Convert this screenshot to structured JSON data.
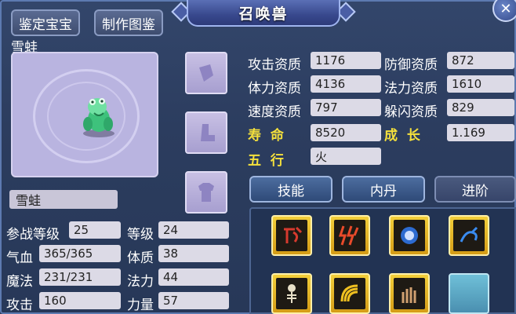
{
  "window": {
    "title": "召唤兽",
    "close_symbol": "✕"
  },
  "toolbar": {
    "identify_label": "鉴定宝宝",
    "atlas_label": "制作图鉴"
  },
  "pet": {
    "name_display": "雪蛙",
    "name_field": "雪蛙"
  },
  "left_stats": [
    {
      "label": "参战等级",
      "value": "25"
    },
    {
      "label": "等级",
      "value": "24"
    },
    {
      "label": "气血",
      "value": "365/365"
    },
    {
      "label": "体质",
      "value": "38"
    },
    {
      "label": "魔法",
      "value": "231/231"
    },
    {
      "label": "法力",
      "value": "44"
    },
    {
      "label": "攻击",
      "value": "160"
    },
    {
      "label": "力量",
      "value": "57"
    }
  ],
  "aptitudes": [
    {
      "label": "攻击资质",
      "value": "1176"
    },
    {
      "label": "防御资质",
      "value": "872"
    },
    {
      "label": "体力资质",
      "value": "4136"
    },
    {
      "label": "法力资质",
      "value": "1610"
    },
    {
      "label": "速度资质",
      "value": "797"
    },
    {
      "label": "躲闪资质",
      "value": "829"
    }
  ],
  "special": {
    "lifespan_label": "寿  命",
    "lifespan_value": "8520",
    "growth_label": "成  长",
    "growth_value": "1.169",
    "element_label": "五  行",
    "element_value": "火"
  },
  "tabs": {
    "skills": "技能",
    "inner_core": "内丹",
    "advance": "进阶"
  },
  "colors": {
    "panel": "#2c3d5f",
    "accent_yellow": "#f4e03c",
    "skill_gold": "#e5b326"
  }
}
